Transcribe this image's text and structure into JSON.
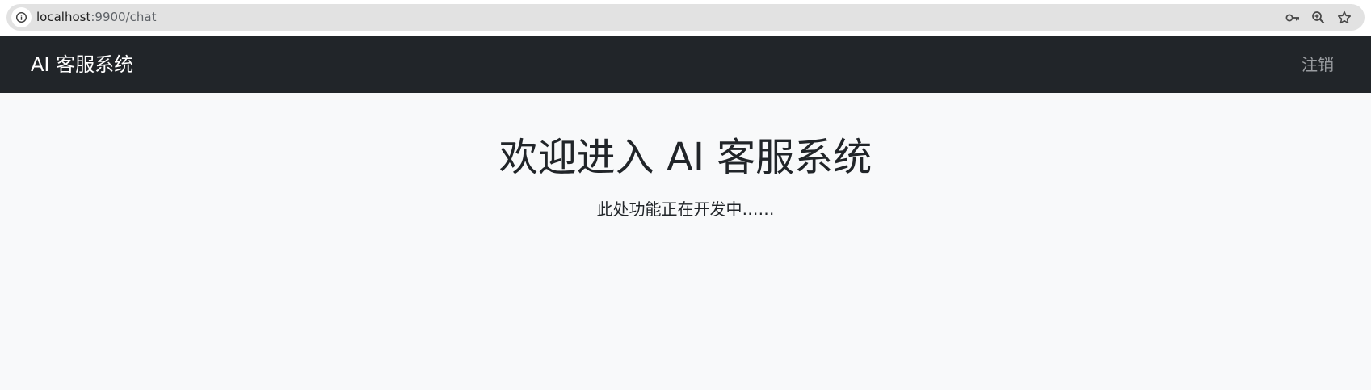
{
  "browser": {
    "url_host": "localhost",
    "url_path": ":9900/chat",
    "icons": [
      "info-icon",
      "key-icon",
      "zoom-icon",
      "star-icon"
    ]
  },
  "navbar": {
    "brand": "AI 客服系统",
    "logout_label": "注销",
    "background": "#212529"
  },
  "main": {
    "title": "欢迎进入 AI 客服系统",
    "subtitle": "此处功能正在开发中……",
    "background": "#f8f9fa"
  }
}
